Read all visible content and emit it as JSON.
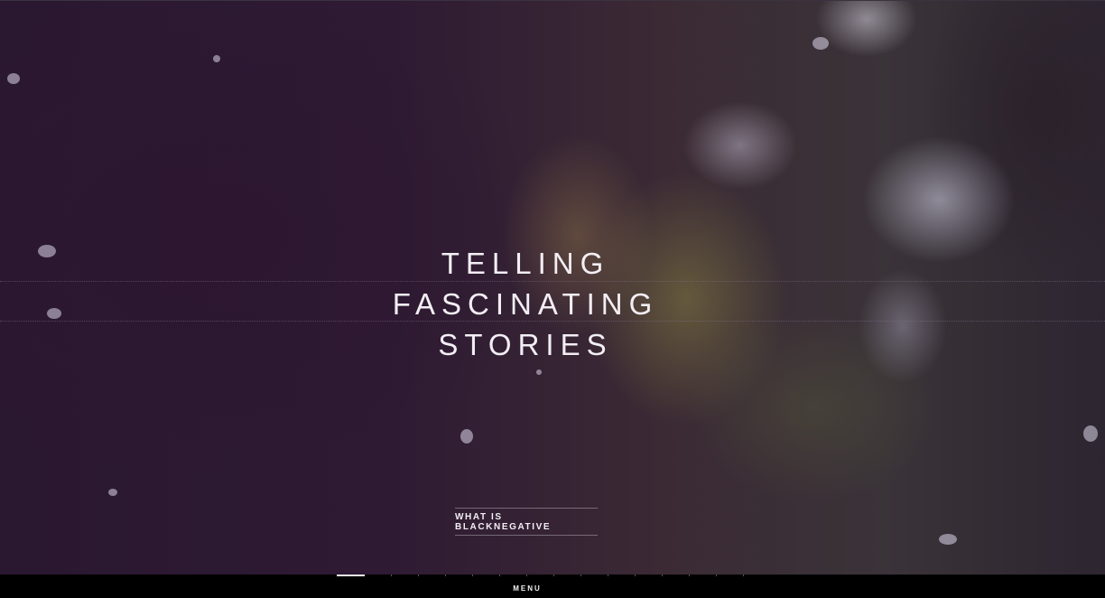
{
  "hero": {
    "headline_lines": [
      "TELLING",
      "FASCINATING",
      "STORIES"
    ],
    "cta_label": "WHAT IS BLACKNEGATIVE"
  },
  "menu": {
    "label": "MENU",
    "slides_total": 15,
    "slide_active": 1
  },
  "colors": {
    "menu_bar": "#000000",
    "headline": "#f3eef4",
    "overlay": "#2a1830"
  }
}
